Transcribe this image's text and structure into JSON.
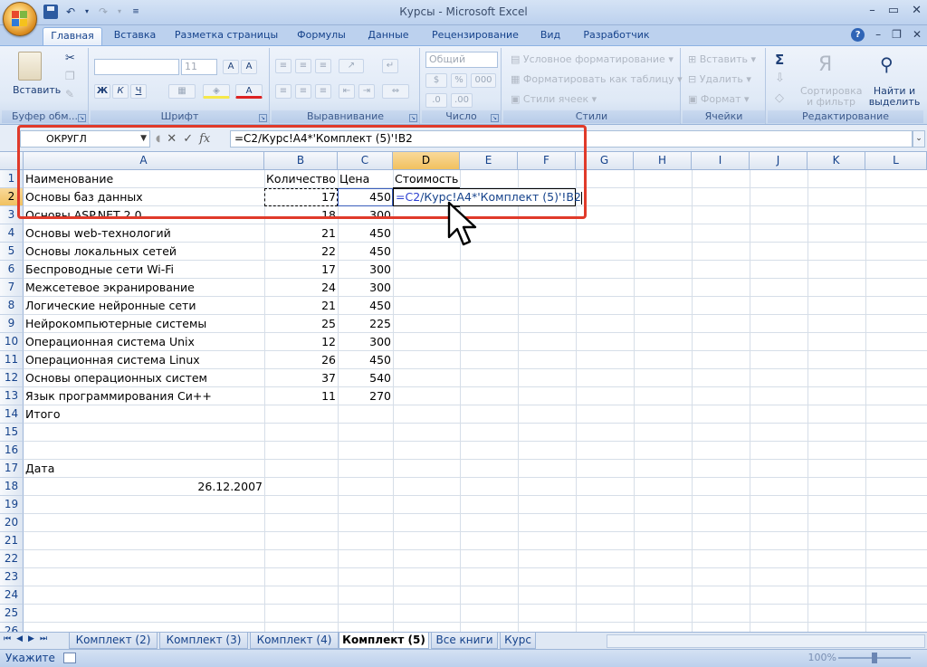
{
  "window": {
    "title": "Курсы - Microsoft Excel"
  },
  "ribbon_tabs": [
    "Главная",
    "Вставка",
    "Разметка страницы",
    "Формулы",
    "Данные",
    "Рецензирование",
    "Вид",
    "Разработчик"
  ],
  "ribbon": {
    "clipboard": {
      "label": "Буфер обм...",
      "paste": "Вставить"
    },
    "font": {
      "label": "Шрифт",
      "size": "11",
      "bold": "Ж",
      "italic": "К",
      "underline": "Ч"
    },
    "alignment": {
      "label": "Выравнивание"
    },
    "number": {
      "label": "Число",
      "format": "Общий"
    },
    "styles": {
      "label": "Стили",
      "conditional": "Условное форматирование",
      "as_table": "Форматировать как таблицу",
      "cell_styles": "Стили ячеек"
    },
    "cells": {
      "label": "Ячейки",
      "insert": "Вставить",
      "delete": "Удалить",
      "format": "Формат"
    },
    "editing": {
      "label": "Редактирование",
      "sort": "Сортировка и фильтр",
      "find": "Найти и выделить"
    }
  },
  "formula_bar": {
    "name_box": "ОКРУГЛ",
    "fx": "fx",
    "formula": "=C2/Курс!A4*'Комплект (5)'!B2"
  },
  "columns": [
    "A",
    "B",
    "C",
    "D",
    "E",
    "F",
    "G",
    "H",
    "I",
    "J",
    "K",
    "L"
  ],
  "rows": [
    "1",
    "2",
    "3",
    "4",
    "5",
    "6",
    "7",
    "8",
    "9",
    "10",
    "11",
    "12",
    "13",
    "14",
    "15",
    "16",
    "17",
    "18",
    "19",
    "20",
    "21",
    "22",
    "23",
    "24",
    "25",
    "26"
  ],
  "sheet": {
    "header": {
      "name": "Наименование",
      "qty": "Количество",
      "price": "Цена",
      "cost": "Стоимость"
    },
    "items": [
      {
        "name": "Основы баз данных",
        "qty": "17",
        "price": "450"
      },
      {
        "name": "Основы ASP.NET 2.0",
        "qty": "18",
        "price": "300"
      },
      {
        "name": "Основы web-технологий",
        "qty": "21",
        "price": "450"
      },
      {
        "name": "Основы локальных сетей",
        "qty": "22",
        "price": "450"
      },
      {
        "name": "Беспроводные сети Wi-Fi",
        "qty": "17",
        "price": "300"
      },
      {
        "name": "Межсетевое экранирование",
        "qty": "24",
        "price": "300"
      },
      {
        "name": "Логические нейронные сети",
        "qty": "21",
        "price": "450"
      },
      {
        "name": "Нейрокомпьютерные системы",
        "qty": "25",
        "price": "225"
      },
      {
        "name": "Операционная система Unix",
        "qty": "12",
        "price": "300"
      },
      {
        "name": "Операционная система Linux",
        "qty": "26",
        "price": "450"
      },
      {
        "name": "Основы операционных систем",
        "qty": "37",
        "price": "540"
      },
      {
        "name": "Язык программирования Си++",
        "qty": "11",
        "price": "270"
      }
    ],
    "total_label": "Итого",
    "date_label": "Дата",
    "date_value": "26.12.2007",
    "edit": {
      "ref1": "=C2",
      "text": "/Курс!A4*'Комплект (5)'!B2"
    }
  },
  "sheet_tabs": [
    "Комплект (2)",
    "Комплект (3)",
    "Комплект (4)",
    "Комплект (5)",
    "Все книги",
    "Курс"
  ],
  "active_sheet": "Комплект (5)",
  "status": {
    "mode": "Укажите",
    "zoom": "100%"
  },
  "colors": {
    "accent": "#15428b",
    "highlight": "#e03a2a",
    "selected_header": "#f1c15f"
  }
}
